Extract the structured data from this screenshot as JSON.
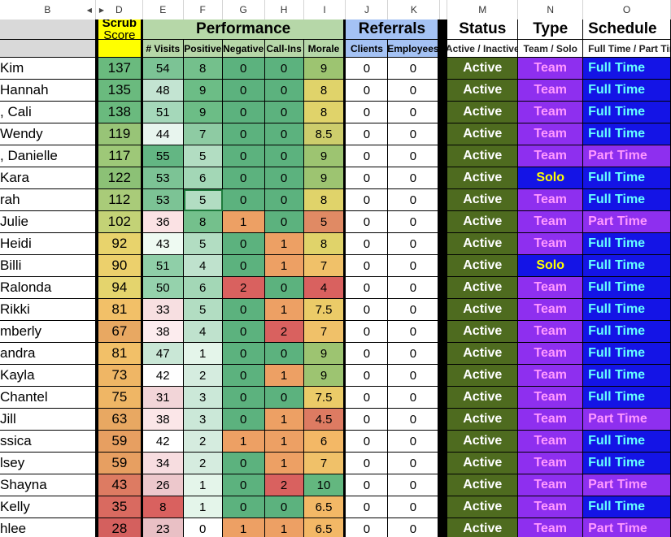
{
  "column_letters": [
    "B",
    "D",
    "E",
    "F",
    "G",
    "H",
    "I",
    "J",
    "K",
    "M",
    "N",
    "O"
  ],
  "hidden_column_markers": {
    "left_arrow": "◀",
    "right_arrow": "▶"
  },
  "header": {
    "blank": "",
    "scrub_line1": "Scrub",
    "scrub_line2": "Score",
    "performance": "Performance",
    "referrals": "Referrals",
    "status": "Status",
    "type": "Type",
    "schedule": "Schedule"
  },
  "subheader": {
    "visits": "# Visits",
    "positive": "Positive",
    "negative": "Negative",
    "callins": "Call-Ins",
    "morale": "Morale",
    "clients": "Clients",
    "employees": "Employees",
    "status": "Active / Inactive",
    "type": "Team / Solo",
    "schedule": "Full Time / Part Time"
  },
  "colors": {
    "scrub_header_bg": "#ffff00",
    "performance_bg": "#b6d7a8",
    "referrals_bg": "#a4c2f4",
    "status_bg": "#4e6b1f",
    "status_fg": "#ffffff",
    "team_bg": "#8e2fef",
    "team_fg": "#ff99ff",
    "solo_bg": "#1414e6",
    "solo_fg": "#ffff00",
    "fulltime_bg": "#1414e6",
    "fulltime_fg": "#66ffff",
    "parttime_bg": "#8e2fef",
    "parttime_fg": "#ff99ff"
  },
  "rows": [
    {
      "name": "Kim",
      "scrub": "137",
      "visits": "54",
      "positive": "8",
      "negative": "0",
      "callins": "0",
      "morale": "9",
      "clients": "0",
      "employees": "0",
      "status": "Active",
      "type": "Team",
      "schedule": "Full Time",
      "c": {
        "scrub": "#6aba7e",
        "visits": "#7cc395",
        "positive": "#74c08c",
        "negative": "#5cb27e",
        "callins": "#5cb27e",
        "morale": "#9dc471"
      }
    },
    {
      "name": "Hannah",
      "scrub": "135",
      "visits": "48",
      "positive": "9",
      "negative": "0",
      "callins": "0",
      "morale": "8",
      "clients": "0",
      "employees": "0",
      "status": "Active",
      "type": "Team",
      "schedule": "Full Time",
      "c": {
        "scrub": "#6aba7e",
        "visits": "#c3e4d2",
        "positive": "#6cbd86",
        "negative": "#5cb27e",
        "callins": "#5cb27e",
        "morale": "#e0d36a"
      }
    },
    {
      "name": ", Cali",
      "scrub": "138",
      "visits": "51",
      "positive": "9",
      "negative": "0",
      "callins": "0",
      "morale": "8",
      "clients": "0",
      "employees": "0",
      "status": "Active",
      "type": "Team",
      "schedule": "Full Time",
      "c": {
        "scrub": "#6aba7e",
        "visits": "#a5d8ba",
        "positive": "#6cbd86",
        "negative": "#5cb27e",
        "callins": "#5cb27e",
        "morale": "#e0d36a"
      }
    },
    {
      "name": "Wendy",
      "scrub": "119",
      "visits": "44",
      "positive": "7",
      "negative": "0",
      "callins": "0",
      "morale": "8.5",
      "clients": "0",
      "employees": "0",
      "status": "Active",
      "type": "Team",
      "schedule": "Full Time",
      "c": {
        "scrub": "#98c477",
        "visits": "#e8f5ee",
        "positive": "#8ecba3",
        "negative": "#5cb27e",
        "callins": "#5cb27e",
        "morale": "#cdcd6c"
      }
    },
    {
      "name": ", Danielle",
      "scrub": "117",
      "visits": "55",
      "positive": "5",
      "negative": "0",
      "callins": "0",
      "morale": "9",
      "clients": "0",
      "employees": "0",
      "status": "Active",
      "type": "Team",
      "schedule": "Part Time",
      "c": {
        "scrub": "#9ec878",
        "visits": "#63b683",
        "positive": "#b2ddc2",
        "negative": "#5cb27e",
        "callins": "#5cb27e",
        "morale": "#9dc471"
      }
    },
    {
      "name": "Kara",
      "scrub": "122",
      "visits": "53",
      "positive": "6",
      "negative": "0",
      "callins": "0",
      "morale": "9",
      "clients": "0",
      "employees": "0",
      "status": "Active",
      "type": "Solo",
      "schedule": "Full Time",
      "c": {
        "scrub": "#8cc176",
        "visits": "#7cc395",
        "positive": "#a3d7b6",
        "negative": "#5cb27e",
        "callins": "#5cb27e",
        "morale": "#9dc471"
      }
    },
    {
      "name": "rah",
      "scrub": "112",
      "visits": "53",
      "positive": "5",
      "negative": "0",
      "callins": "0",
      "morale": "8",
      "clients": "0",
      "employees": "0",
      "status": "Active",
      "type": "Team",
      "schedule": "Full Time",
      "c": {
        "scrub": "#a9cb79",
        "visits": "#7cc395",
        "positive": "#b2ddc2",
        "negative": "#5cb27e",
        "callins": "#5cb27e",
        "morale": "#e0d36a"
      },
      "selected": "positive"
    },
    {
      "name": "Julie",
      "scrub": "102",
      "visits": "36",
      "positive": "8",
      "negative": "1",
      "callins": "0",
      "morale": "5",
      "clients": "0",
      "employees": "0",
      "status": "Active",
      "type": "Team",
      "schedule": "Part Time",
      "c": {
        "scrub": "#c3d276",
        "visits": "#fbe2e4",
        "positive": "#74c08c",
        "negative": "#eda064",
        "callins": "#5cb27e",
        "morale": "#e08a64"
      }
    },
    {
      "name": " Heidi",
      "scrub": "92",
      "visits": "43",
      "positive": "5",
      "negative": "0",
      "callins": "1",
      "morale": "8",
      "clients": "0",
      "employees": "0",
      "status": "Active",
      "type": "Team",
      "schedule": "Full Time",
      "c": {
        "scrub": "#e8d36c",
        "visits": "#eefaf2",
        "positive": "#b2ddc2",
        "negative": "#5cb27e",
        "callins": "#eda064",
        "morale": "#e0d36a"
      }
    },
    {
      "name": "Billi",
      "scrub": "90",
      "visits": "51",
      "positive": "4",
      "negative": "0",
      "callins": "1",
      "morale": "7",
      "clients": "0",
      "employees": "0",
      "status": "Active",
      "type": "Solo",
      "schedule": "Full Time",
      "c": {
        "scrub": "#ecd06c",
        "visits": "#8fcfa8",
        "positive": "#bfe2cd",
        "negative": "#5cb27e",
        "callins": "#eda064",
        "morale": "#f0c169"
      }
    },
    {
      "name": "Ralonda",
      "scrub": "94",
      "visits": "50",
      "positive": "6",
      "negative": "2",
      "callins": "0",
      "morale": "4",
      "clients": "0",
      "employees": "0",
      "status": "Active",
      "type": "Team",
      "schedule": "Full Time",
      "c": {
        "scrub": "#e4d46d",
        "visits": "#95d2ac",
        "positive": "#a3d7b6",
        "negative": "#d9615f",
        "callins": "#5cb27e",
        "morale": "#d9615f"
      }
    },
    {
      "name": " Rikki",
      "scrub": "81",
      "visits": "33",
      "positive": "5",
      "negative": "0",
      "callins": "1",
      "morale": "7.5",
      "clients": "0",
      "employees": "0",
      "status": "Active",
      "type": "Team",
      "schedule": "Full Time",
      "c": {
        "scrub": "#f2c068",
        "visits": "#f7dfe1",
        "positive": "#b2ddc2",
        "negative": "#5cb27e",
        "callins": "#eda064",
        "morale": "#ebcb68"
      }
    },
    {
      "name": "mberly",
      "scrub": "67",
      "visits": "38",
      "positive": "4",
      "negative": "0",
      "callins": "2",
      "morale": "7",
      "clients": "0",
      "employees": "0",
      "status": "Active",
      "type": "Team",
      "schedule": "Full Time",
      "c": {
        "scrub": "#e8a862",
        "visits": "#fcecee",
        "positive": "#bfe2cd",
        "negative": "#5cb27e",
        "callins": "#d9615f",
        "morale": "#f0c169"
      }
    },
    {
      "name": "andra",
      "scrub": "81",
      "visits": "47",
      "positive": "1",
      "negative": "0",
      "callins": "0",
      "morale": "9",
      "clients": "0",
      "employees": "0",
      "status": "Active",
      "type": "Team",
      "schedule": "Full Time",
      "c": {
        "scrub": "#f2c068",
        "visits": "#c9e7d6",
        "positive": "#e4f5ea",
        "negative": "#5cb27e",
        "callins": "#5cb27e",
        "morale": "#9dc471"
      }
    },
    {
      "name": "Kayla",
      "scrub": "73",
      "visits": "42",
      "positive": "2",
      "negative": "0",
      "callins": "1",
      "morale": "9",
      "clients": "0",
      "employees": "0",
      "status": "Active",
      "type": "Team",
      "schedule": "Full Time",
      "c": {
        "scrub": "#efb665",
        "visits": "#fefefe",
        "positive": "#d5ecdf",
        "negative": "#5cb27e",
        "callins": "#eda064",
        "morale": "#9dc471"
      }
    },
    {
      "name": " Chantel",
      "scrub": "75",
      "visits": "31",
      "positive": "3",
      "negative": "0",
      "callins": "0",
      "morale": "7.5",
      "clients": "0",
      "employees": "0",
      "status": "Active",
      "type": "Team",
      "schedule": "Full Time",
      "c": {
        "scrub": "#efb665",
        "visits": "#f2d5d8",
        "positive": "#cbe8d8",
        "negative": "#5cb27e",
        "callins": "#5cb27e",
        "morale": "#ebcb68"
      }
    },
    {
      "name": " Jill",
      "scrub": "63",
      "visits": "38",
      "positive": "3",
      "negative": "0",
      "callins": "1",
      "morale": "4.5",
      "clients": "0",
      "employees": "0",
      "status": "Active",
      "type": "Team",
      "schedule": "Part Time",
      "c": {
        "scrub": "#e8a862",
        "visits": "#fbe6e8",
        "positive": "#cbe8d8",
        "negative": "#5cb27e",
        "callins": "#eda064",
        "morale": "#dd7b62"
      }
    },
    {
      "name": "ssica",
      "scrub": "59",
      "visits": "42",
      "positive": "2",
      "negative": "1",
      "callins": "1",
      "morale": "6",
      "clients": "0",
      "employees": "0",
      "status": "Active",
      "type": "Team",
      "schedule": "Full Time",
      "c": {
        "scrub": "#e79f61",
        "visits": "#ffffff",
        "positive": "#d5ecdf",
        "negative": "#eda064",
        "callins": "#eda064",
        "morale": "#f3b866"
      }
    },
    {
      "name": "lsey",
      "scrub": "59",
      "visits": "34",
      "positive": "2",
      "negative": "0",
      "callins": "1",
      "morale": "7",
      "clients": "0",
      "employees": "0",
      "status": "Active",
      "type": "Team",
      "schedule": "Full Time",
      "c": {
        "scrub": "#e79f61",
        "visits": "#f7dde0",
        "positive": "#d5ecdf",
        "negative": "#5cb27e",
        "callins": "#eda064",
        "morale": "#f0c169"
      }
    },
    {
      "name": "Shayna",
      "scrub": "43",
      "visits": "26",
      "positive": "1",
      "negative": "0",
      "callins": "2",
      "morale": "10",
      "clients": "0",
      "employees": "0",
      "status": "Active",
      "type": "Team",
      "schedule": "Part Time",
      "c": {
        "scrub": "#dd7b62",
        "visits": "#edc8cc",
        "positive": "#e4f5ea",
        "negative": "#5cb27e",
        "callins": "#d9615f",
        "morale": "#63b77f"
      }
    },
    {
      "name": "Kelly",
      "scrub": "35",
      "visits": "8",
      "positive": "1",
      "negative": "0",
      "callins": "0",
      "morale": "6.5",
      "clients": "0",
      "employees": "0",
      "status": "Active",
      "type": "Team",
      "schedule": "Full Time",
      "c": {
        "scrub": "#d96a60",
        "visits": "#d9615f",
        "positive": "#e4f5ea",
        "negative": "#5cb27e",
        "callins": "#5cb27e",
        "morale": "#f3b866"
      }
    },
    {
      "name": "hlee",
      "scrub": "28",
      "visits": "23",
      "positive": "0",
      "negative": "1",
      "callins": "1",
      "morale": "6.5",
      "clients": "0",
      "employees": "0",
      "status": "Active",
      "type": "Team",
      "schedule": "Part Time",
      "c": {
        "scrub": "#d4605e",
        "visits": "#e9c0c5",
        "positive": "#ffffff",
        "negative": "#eda064",
        "callins": "#eda064",
        "morale": "#f3b866"
      }
    }
  ]
}
